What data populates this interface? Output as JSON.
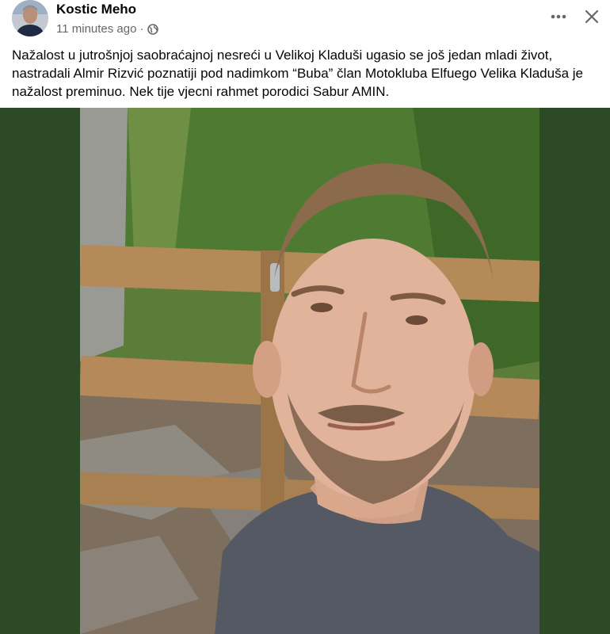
{
  "post": {
    "author": "Kostic Meho",
    "timestamp": "11 minutes ago",
    "separator": "·",
    "audience_icon": "globe-icon",
    "more_icon": "more-horizontal-icon",
    "close_icon": "close-icon",
    "text": "Nažalost u jutrošnjoj saobraćajnoj nesreći u Velikoj Kladuši ugasio se još jedan mladi život, nastradali Almir Rizvić poznatiji pod nadimkom “Buba” član Motokluba Elfuego Velika Kladuša je nažalost preminuo. Nek tije vjecni rahmet porodici Sabur AMIN."
  },
  "media": {
    "background_color": "#2c4a26",
    "photo_subject": "selfie of a man in front of a wooden fence and greenery"
  },
  "colors": {
    "text_primary": "#050505",
    "text_secondary": "#65676b",
    "media_background": "#2c4a26"
  }
}
